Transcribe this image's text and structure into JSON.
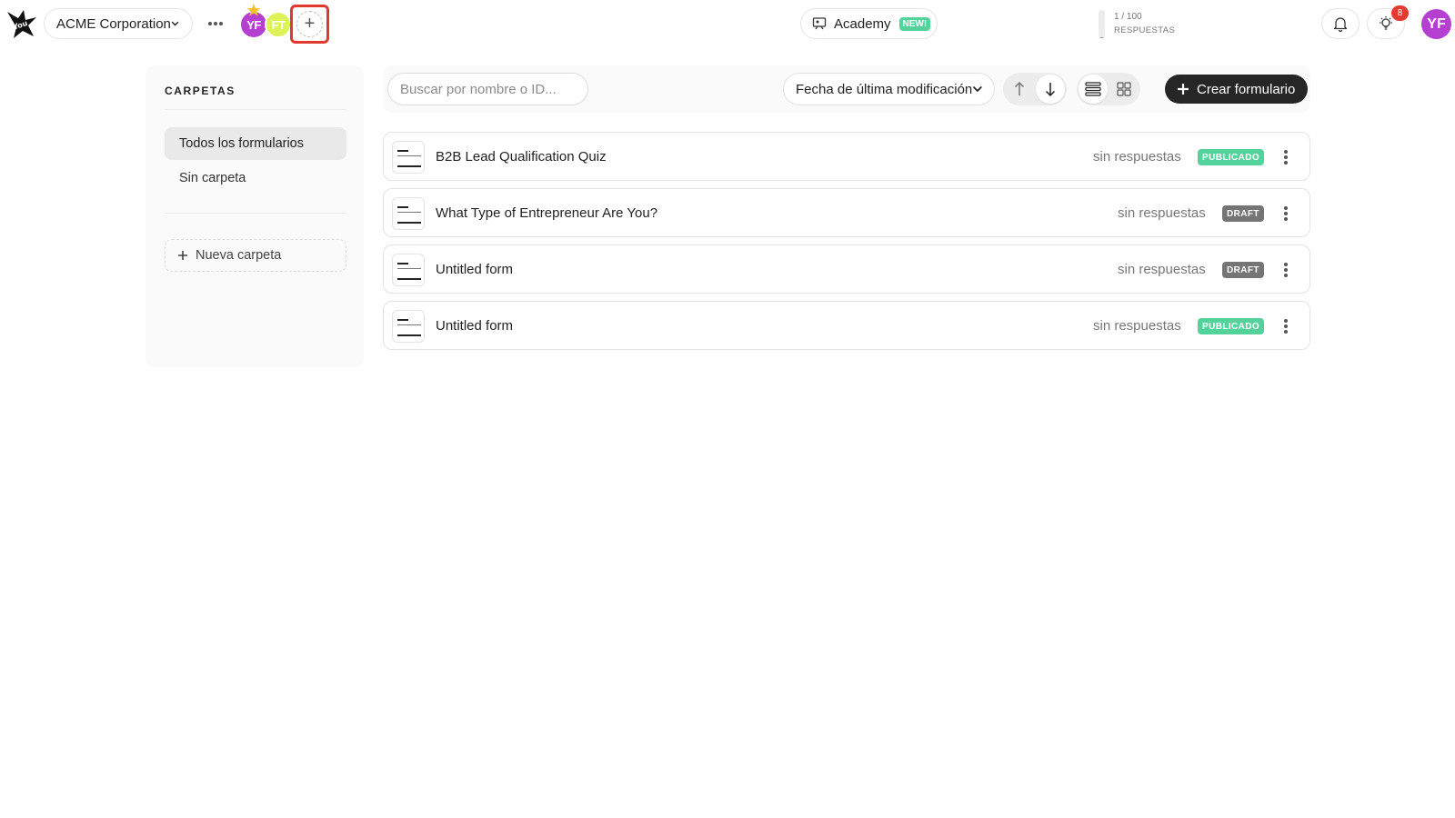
{
  "header": {
    "workspace_name": "ACME Corporation",
    "members": [
      {
        "initials": "YF",
        "color": "#b53fd0"
      },
      {
        "initials": "FT",
        "color": "#dff25a"
      }
    ],
    "invite_symbol": "+",
    "academy": {
      "label": "Academy",
      "badge": "NEW!"
    },
    "quota": {
      "count": "1 / 100",
      "label": "RESPUESTAS",
      "used_fraction": 0.01
    },
    "notifications_badge": "8",
    "user_initials": "YF",
    "accent_color": "#b53fd0"
  },
  "sidebar": {
    "title": "CARPETAS",
    "items": [
      {
        "label": "Todos los formularios",
        "active": true
      },
      {
        "label": "Sin carpeta",
        "active": false
      }
    ],
    "new_folder_label": "Nueva carpeta"
  },
  "toolbar": {
    "search_placeholder": "Buscar por nombre o ID...",
    "sort_label": "Fecha de última modificación",
    "create_label": "Crear formulario"
  },
  "forms": [
    {
      "title": "B2B Lead Qualification Quiz",
      "responses": "sin respuestas",
      "status": "PUBLICADO",
      "status_color": "#53d39b"
    },
    {
      "title": "What Type of Entrepreneur Are You?",
      "responses": "sin respuestas",
      "status": "DRAFT",
      "status_color": "#757575"
    },
    {
      "title": "Untitled form",
      "responses": "sin respuestas",
      "status": "DRAFT",
      "status_color": "#757575"
    },
    {
      "title": "Untitled form",
      "responses": "sin respuestas",
      "status": "PUBLICADO",
      "status_color": "#53d39b"
    }
  ]
}
